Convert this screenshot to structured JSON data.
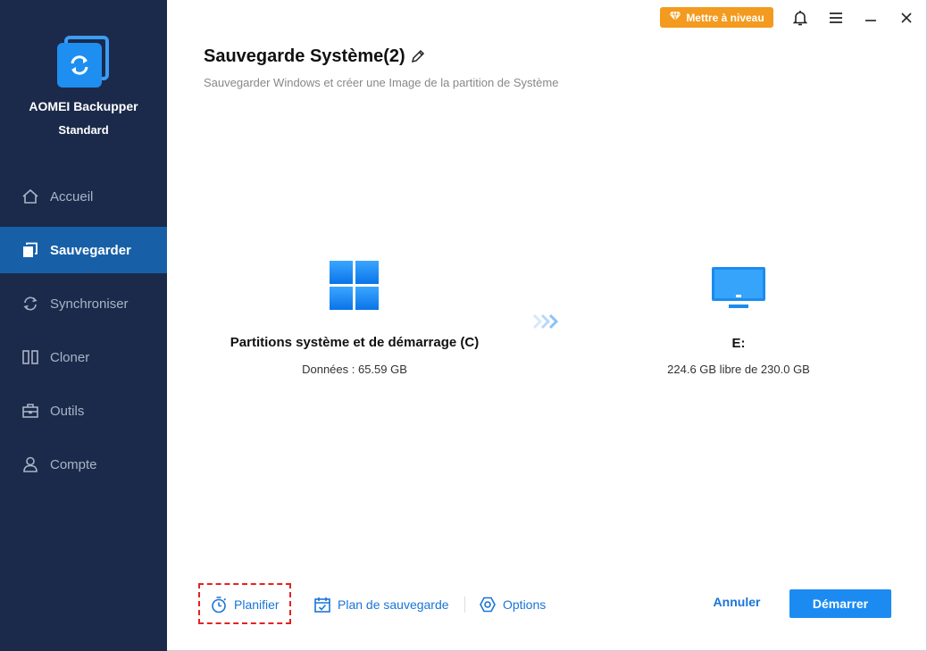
{
  "app": {
    "name": "AOMEI Backupper",
    "edition": "Standard"
  },
  "nav": {
    "items": [
      {
        "label": "Accueil",
        "icon": "home-icon",
        "active": false
      },
      {
        "label": "Sauvegarder",
        "icon": "backup-icon",
        "active": true
      },
      {
        "label": "Synchroniser",
        "icon": "sync-icon",
        "active": false
      },
      {
        "label": "Cloner",
        "icon": "clone-icon",
        "active": false
      },
      {
        "label": "Outils",
        "icon": "toolbox-icon",
        "active": false
      },
      {
        "label": "Compte",
        "icon": "user-icon",
        "active": false
      }
    ]
  },
  "topbar": {
    "upgrade_label": "Mettre à niveau"
  },
  "page": {
    "title": "Sauvegarde Système(2)",
    "subtitle": "Sauvegarder Windows et créer une Image de la partition de Système"
  },
  "source": {
    "title": "Partitions système et de démarrage (C)",
    "detail": "Données : 65.59 GB"
  },
  "destination": {
    "title": "E:",
    "detail": "224.6 GB libre de 230.0 GB"
  },
  "actions": {
    "schedule_label": "Planifier",
    "backup_plan_label": "Plan de sauvegarde",
    "options_label": "Options",
    "cancel_label": "Annuler",
    "start_label": "Démarrer"
  },
  "colors": {
    "sidebar_bg": "#1b2a4a",
    "active_nav": "#1760a8",
    "accent": "#1b8bf2",
    "upgrade": "#f39a1f",
    "highlight_border": "#e52222"
  }
}
